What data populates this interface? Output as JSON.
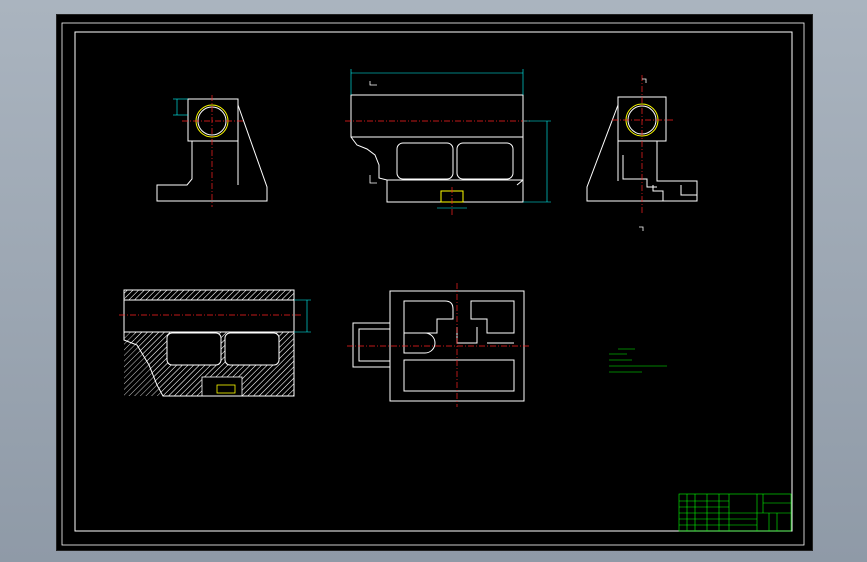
{
  "colors": {
    "outline": "#ffffff",
    "centerline": "#ff2222",
    "dimension": "#00ffff",
    "notes": "#00ff00",
    "hatch": "#ffffff",
    "hidden": "#ffff00",
    "title_block": "#00ff00"
  },
  "views": {
    "front_label": "",
    "top_section_label": "",
    "bottom_view_label": ""
  }
}
